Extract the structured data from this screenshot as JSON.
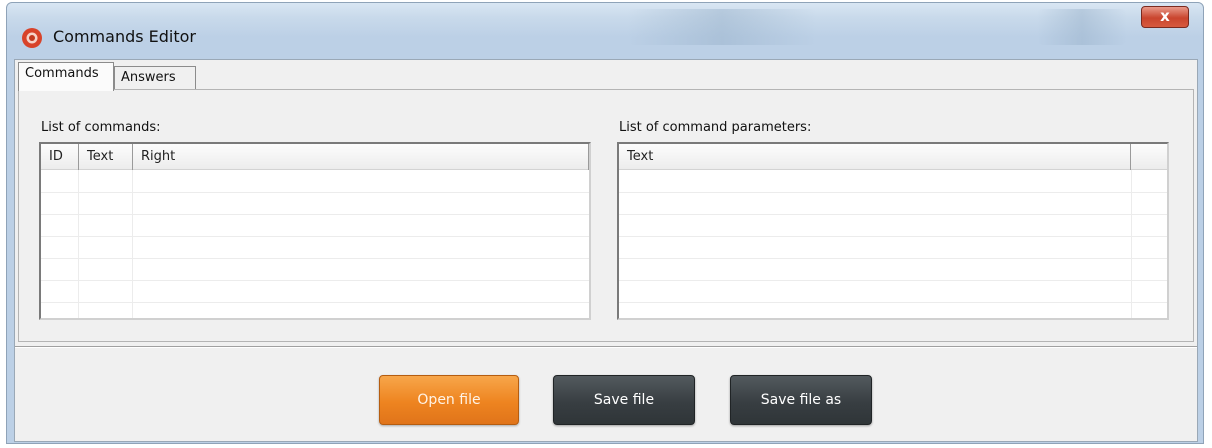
{
  "window": {
    "title": "Commands Editor",
    "close_glyph": "x"
  },
  "tabs": [
    {
      "label": "Commands",
      "active": true
    },
    {
      "label": "Answers",
      "active": false
    }
  ],
  "commands_panel": {
    "label": "List of commands:",
    "columns": [
      "ID",
      "Text",
      "Right"
    ],
    "rows": []
  },
  "parameters_panel": {
    "label": "List of command parameters:",
    "columns": [
      "Text"
    ],
    "rows": []
  },
  "buttons": {
    "open_file": "Open file",
    "save_file": "Save file",
    "save_file_as": "Save file as"
  },
  "colors": {
    "accent_orange": "#ee8420",
    "button_dark": "#383e42"
  },
  "icons": {
    "app": "app-logo-icon",
    "close": "close-icon"
  }
}
